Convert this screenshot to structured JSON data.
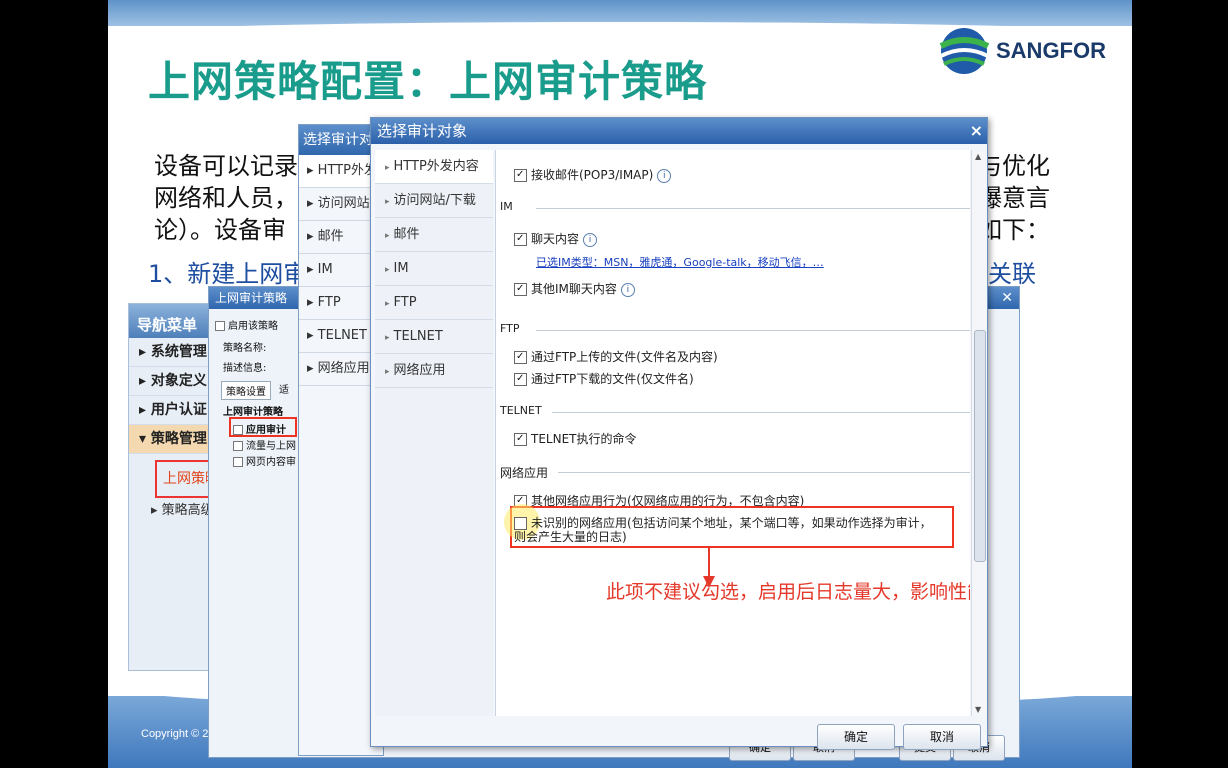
{
  "slide": {
    "title": "上网策略配置：上网审计策略",
    "logo_text": "SANGFOR",
    "copyright": "Copyright © 2",
    "body_lines": [
      "设备可以记录",
      "网络和人员，",
      "论）。设备审"
    ],
    "body_right": [
      "与优化",
      "爆意言",
      "如下："
    ],
    "blue_line_left": "1、新建上网审",
    "blue_line_right": "关联"
  },
  "nav": {
    "header": "导航菜单",
    "items": [
      "系统管理",
      "对象定义",
      "用户认证",
      "策略管理"
    ],
    "sub_active": "上网策略",
    "sub_other": "策略高级"
  },
  "policy_dialog": {
    "title": "上网审计策略",
    "enable_label": "启用该策略",
    "name_label": "策略名称:",
    "desc_label": "描述信息:",
    "tab_settings": "策略设置",
    "tab_other": "适",
    "section": "上网审计策略",
    "options": [
      "应用审计",
      "流量与上网",
      "网页内容审"
    ],
    "ok": "确定",
    "cancel": "取消",
    "submit": "提交"
  },
  "mid_dialog": {
    "title": "选择审计对象",
    "tabs": [
      "HTTP外发",
      "访问网站",
      "邮件",
      "IM",
      "FTP",
      "TELNET",
      "网络应用"
    ],
    "ok": "确定",
    "cancel": "取消"
  },
  "main_dialog": {
    "title": "选择审计对象",
    "close": "×",
    "tabs": [
      "HTTP外发内容",
      "访问网站/下载",
      "邮件",
      "IM",
      "FTP",
      "TELNET",
      "网络应用"
    ],
    "rows": {
      "recv_mail": "接收邮件(POP3/IMAP)",
      "im_section": "IM",
      "chat": "聊天内容",
      "im_types": "已选IM类型：MSN，雅虎通，Google-talk，移动飞信，…",
      "other_im": "其他IM聊天内容",
      "ftp_section": "FTP",
      "ftp_up": "通过FTP上传的文件(文件名及内容)",
      "ftp_down": "通过FTP下载的文件(仅文件名)",
      "telnet_section": "TELNET",
      "telnet_cmd": "TELNET执行的命令",
      "netapp_section": "网络应用",
      "other_app": "其他网络应用行为(仅网络应用的行为，不包含内容)",
      "unknown_app_1": "未识别的网络应用(包括访问某个地址，某个端口等，如果动作选择为审计，",
      "unknown_app_2": "则会产生大量的日志)"
    },
    "annotation": "此项不建议勾选，启用后日志量大，影响性能",
    "ok": "确定",
    "cancel": "取消"
  },
  "colors": {
    "title": "#1a9c8c",
    "annotation": "#e4382a",
    "highlight": "#e32222"
  }
}
